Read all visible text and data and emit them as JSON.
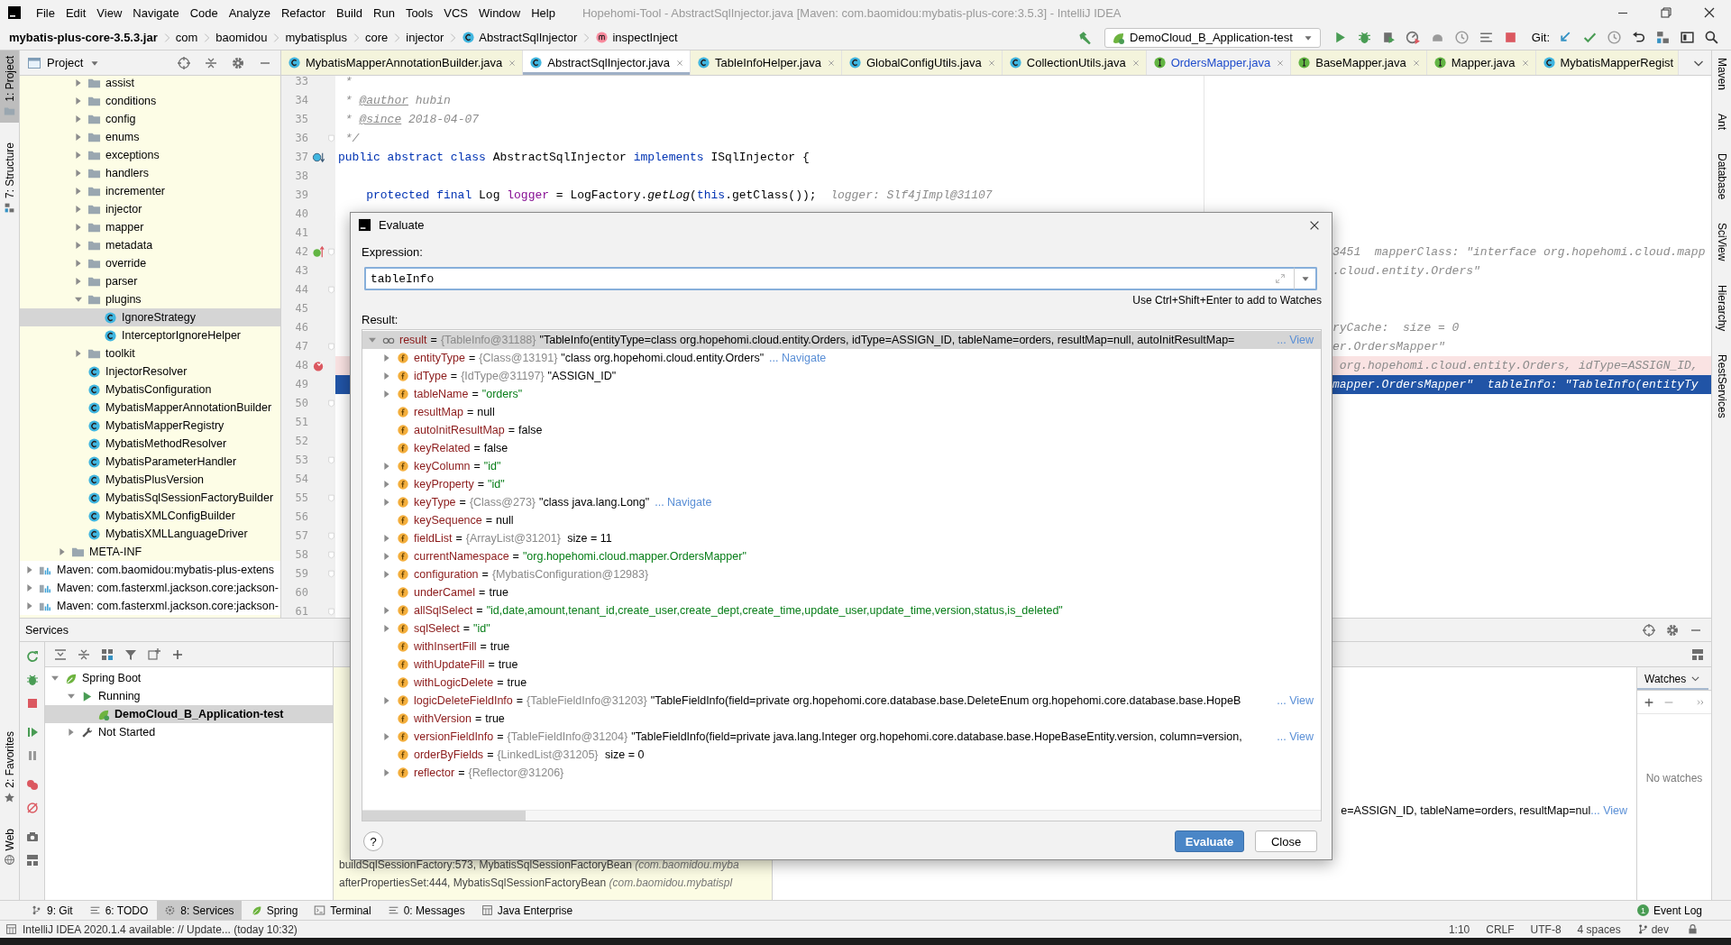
{
  "window": {
    "title": "Hopehomi-Tool - AbstractSqlInjector.java [Maven: com.baomidou:mybatis-plus-core:3.5.3] - IntelliJ IDEA"
  },
  "menu": [
    "File",
    "Edit",
    "View",
    "Navigate",
    "Code",
    "Analyze",
    "Refactor",
    "Build",
    "Run",
    "Tools",
    "VCS",
    "Window",
    "Help"
  ],
  "breadcrumbs": [
    {
      "label": "mybatis-plus-core-3.5.3.jar",
      "kind": "jar"
    },
    {
      "label": "com",
      "kind": "package"
    },
    {
      "label": "baomidou",
      "kind": "package"
    },
    {
      "label": "mybatisplus",
      "kind": "package"
    },
    {
      "label": "core",
      "kind": "package"
    },
    {
      "label": "injector",
      "kind": "package"
    },
    {
      "label": "AbstractSqlInjector",
      "kind": "class"
    },
    {
      "label": "inspectInject",
      "kind": "method"
    }
  ],
  "run_config": {
    "label": "DemoCloud_B_Application-test"
  },
  "vcs_label": "Git:",
  "left_tool_windows": {
    "top": [
      {
        "label": "1: Project",
        "selected": true
      },
      {
        "label": "7: Structure",
        "selected": false
      }
    ],
    "bottom": [
      {
        "label": "2: Favorites",
        "selected": false
      },
      {
        "label": "Web",
        "selected": false
      }
    ]
  },
  "right_tool_windows": [
    "Maven",
    "Ant",
    "Database",
    "SciView",
    "Hierarchy",
    "RestServices"
  ],
  "project": {
    "title": "Project",
    "tree": [
      {
        "children": [
          {
            "children": [
              {
                "children": [
                  {
                    "label": "assist",
                    "kind": "folder",
                    "expanded": false,
                    "selected": false
                  },
                  {
                    "label": "conditions",
                    "kind": "folder",
                    "expanded": false,
                    "selected": false
                  },
                  {
                    "label": "config",
                    "kind": "folder",
                    "expanded": false,
                    "selected": false
                  },
                  {
                    "label": "enums",
                    "kind": "folder",
                    "expanded": false,
                    "selected": false
                  },
                  {
                    "label": "exceptions",
                    "kind": "folder",
                    "expanded": false,
                    "selected": false
                  },
                  {
                    "label": "handlers",
                    "kind": "folder",
                    "expanded": false,
                    "selected": false
                  },
                  {
                    "label": "incrementer",
                    "kind": "folder",
                    "expanded": false,
                    "selected": false
                  },
                  {
                    "label": "injector",
                    "kind": "folder",
                    "expanded": false,
                    "selected": false
                  },
                  {
                    "label": "mapper",
                    "kind": "folder",
                    "expanded": false,
                    "selected": false
                  },
                  {
                    "label": "metadata",
                    "kind": "folder",
                    "expanded": false,
                    "selected": false
                  },
                  {
                    "label": "override",
                    "kind": "folder",
                    "expanded": false,
                    "selected": false
                  },
                  {
                    "label": "parser",
                    "kind": "folder",
                    "expanded": false,
                    "selected": false
                  },
                  {
                    "label": "plugins",
                    "kind": "folder",
                    "expanded": true,
                    "selected": false,
                    "children": [
                      {
                        "label": "IgnoreStrategy",
                        "kind": "class",
                        "selected": true
                      },
                      {
                        "label": "InterceptorIgnoreHelper",
                        "kind": "class",
                        "selected": false
                      }
                    ]
                  },
                  {
                    "label": "toolkit",
                    "kind": "folder",
                    "expanded": false,
                    "selected": false
                  },
                  {
                    "label": "InjectorResolver",
                    "kind": "class",
                    "selected": false
                  },
                  {
                    "label": "MybatisConfiguration",
                    "kind": "class",
                    "selected": false
                  },
                  {
                    "label": "MybatisMapperAnnotationBuilder",
                    "kind": "class",
                    "selected": false
                  },
                  {
                    "label": "MybatisMapperRegistry",
                    "kind": "class",
                    "selected": false
                  },
                  {
                    "label": "MybatisMethodResolver",
                    "kind": "class",
                    "selected": false
                  },
                  {
                    "label": "MybatisParameterHandler",
                    "kind": "class",
                    "selected": false
                  },
                  {
                    "label": "MybatisPlusVersion",
                    "kind": "class",
                    "selected": false
                  },
                  {
                    "label": "MybatisSqlSessionFactoryBuilder",
                    "kind": "class",
                    "selected": false
                  },
                  {
                    "label": "MybatisXMLConfigBuilder",
                    "kind": "class",
                    "selected": false
                  },
                  {
                    "label": "MybatisXMLLanguageDriver",
                    "kind": "class",
                    "selected": false
                  }
                ]
              },
              {
                "label": "META-INF",
                "kind": "folder",
                "expanded": false,
                "selected": false
              }
            ]
          }
        ]
      },
      {
        "label": "Maven: com.baomidou:mybatis-plus-extens",
        "kind": "library",
        "expanded": false,
        "selected": false
      },
      {
        "label": "Maven: com.fasterxml.jackson.core:jackson-",
        "kind": "library",
        "expanded": false,
        "selected": false
      },
      {
        "label": "Maven: com.fasterxml.jackson.core:jackson-",
        "kind": "library",
        "expanded": false,
        "selected": false
      }
    ]
  },
  "editor": {
    "tabs": [
      {
        "label": "MybatisMapperAnnotationBuilder.java",
        "kind": "class",
        "selected": false,
        "library": true,
        "modified": false,
        "closable": true
      },
      {
        "label": "AbstractSqlInjector.java",
        "kind": "class",
        "selected": true,
        "library": true,
        "modified": false,
        "closable": true
      },
      {
        "label": "TableInfoHelper.java",
        "kind": "class",
        "selected": false,
        "library": true,
        "modified": false,
        "closable": true
      },
      {
        "label": "GlobalConfigUtils.java",
        "kind": "class",
        "selected": false,
        "library": true,
        "modified": false,
        "closable": true
      },
      {
        "label": "CollectionUtils.java",
        "kind": "class",
        "selected": false,
        "library": true,
        "modified": false,
        "closable": true
      },
      {
        "label": "OrdersMapper.java",
        "kind": "interface",
        "selected": false,
        "library": false,
        "modified": true,
        "closable": true
      },
      {
        "label": "BaseMapper.java",
        "kind": "interface",
        "selected": false,
        "library": true,
        "modified": false,
        "closable": true
      },
      {
        "label": "Mapper.java",
        "kind": "interface",
        "selected": false,
        "library": true,
        "modified": false,
        "closable": true
      },
      {
        "label": "MybatisMapperRegist",
        "kind": "class",
        "selected": false,
        "library": true,
        "modified": false,
        "closable": false
      }
    ],
    "lines": [
      {
        "num": "33",
        "kind": "code",
        "fold": false,
        "tokens": [
          {
            "kind": "comment",
            "text": " *"
          }
        ]
      },
      {
        "num": "34",
        "kind": "code",
        "fold": false,
        "tokens": [
          {
            "kind": "comment",
            "text": " * "
          },
          {
            "kind": "tag",
            "text": "@author"
          },
          {
            "kind": "comment",
            "text": " hubin"
          }
        ]
      },
      {
        "num": "35",
        "kind": "code",
        "fold": false,
        "tokens": [
          {
            "kind": "comment",
            "text": " * "
          },
          {
            "kind": "tag",
            "text": "@since"
          },
          {
            "kind": "comment",
            "text": " 2018-04-07"
          }
        ]
      },
      {
        "num": "36",
        "kind": "code",
        "fold": true,
        "tokens": [
          {
            "kind": "comment",
            "text": " */"
          }
        ]
      },
      {
        "num": "37",
        "kind": "code",
        "fold": false,
        "tokens": [
          {
            "kind": "keyword",
            "text": "public abstract class"
          },
          {
            "kind": "plain",
            "text": " AbstractSqlInjector "
          },
          {
            "kind": "keyword",
            "text": "implements"
          },
          {
            "kind": "plain",
            "text": " ISqlInjector {"
          }
        ]
      },
      {
        "num": "38",
        "kind": "code",
        "fold": false
      },
      {
        "num": "39",
        "kind": "code",
        "fold": false,
        "tokens": [
          {
            "kind": "keyword",
            "text": "    protected final"
          },
          {
            "kind": "plain",
            "text": " Log "
          },
          {
            "kind": "field",
            "text": "logger"
          },
          {
            "kind": "plain",
            "text": " = LogFactory."
          },
          {
            "kind": "static",
            "text": "getLog"
          },
          {
            "kind": "plain",
            "text": "("
          },
          {
            "kind": "keyword",
            "text": "this"
          },
          {
            "kind": "plain",
            "text": ".getClass());"
          },
          {
            "kind": "hint",
            "text": "  logger: Slf4jImpl@31107"
          }
        ]
      },
      {
        "num": "40",
        "kind": "code",
        "fold": false
      },
      {
        "num": "41",
        "kind": "code",
        "fold": false
      },
      {
        "num": "42",
        "kind": "tail",
        "fold": true,
        "tokens": [
          {
            "kind": "hint",
            "text": "3451  mapperClass: \"interface org.hopehomi.cloud.mapp"
          }
        ]
      },
      {
        "num": "43",
        "kind": "tail",
        "fold": false,
        "tokens": [
          {
            "kind": "hint",
            "text": ".cloud.entity.Orders\""
          }
        ]
      },
      {
        "num": "44",
        "kind": "code",
        "fold": true
      },
      {
        "num": "45",
        "kind": "code",
        "fold": false
      },
      {
        "num": "46",
        "kind": "tail",
        "fold": false,
        "tokens": [
          {
            "kind": "hint",
            "text": "ryCache:  size = 0"
          }
        ]
      },
      {
        "num": "47",
        "kind": "tail",
        "fold": true,
        "tokens": [
          {
            "kind": "hint",
            "text": "er.OrdersMapper\""
          }
        ]
      },
      {
        "num": "48",
        "kind": "breakpoint",
        "fold": false,
        "tokens": [
          {
            "kind": "hint",
            "text": " org.hopehomi.cloud.entity.Orders, idType=ASSIGN_ID,"
          }
        ]
      },
      {
        "num": "49",
        "kind": "execution",
        "fold": false,
        "tokens": [
          {
            "kind": "hint",
            "text": "mapper.OrdersMapper\"  tableInfo: \"TableInfo(entityTy"
          }
        ]
      },
      {
        "num": "50",
        "kind": "code",
        "fold": true
      },
      {
        "num": "51",
        "kind": "code",
        "fold": false
      },
      {
        "num": "52",
        "kind": "code",
        "fold": false
      },
      {
        "num": "53",
        "kind": "code",
        "fold": true
      },
      {
        "num": "54",
        "kind": "code",
        "fold": false
      },
      {
        "num": "55",
        "kind": "code",
        "fold": true
      },
      {
        "num": "56",
        "kind": "code",
        "fold": false
      },
      {
        "num": "57",
        "kind": "code",
        "fold": true
      },
      {
        "num": "58",
        "kind": "code",
        "fold": true
      },
      {
        "num": "59",
        "kind": "code",
        "fold": true
      },
      {
        "num": "60",
        "kind": "code",
        "fold": false
      },
      {
        "num": "61",
        "kind": "code",
        "fold": true
      }
    ]
  },
  "services": {
    "title": "Services",
    "tree": [
      {
        "label": "Spring Boot",
        "expanded": true,
        "selected": false,
        "running": false,
        "children": [
          {
            "label": "Running",
            "expanded": true,
            "selected": false,
            "running": false,
            "children": [
              {
                "label": "DemoCloud_B_Application-test",
                "selected": true,
                "running": true
              }
            ]
          },
          {
            "label": "Not Started",
            "expanded": false,
            "selected": false,
            "running": false
          }
        ]
      }
    ],
    "frames": [
      {
        "method": "buildSqlSessionFactory:573, MybatisSqlSessionFactoryBean",
        "location": "(com.baomidou.myba"
      },
      {
        "method": "afterPropertiesSet:444, MybatisSqlSessionFactoryBean",
        "location": "(com.baomidou.mybatispl"
      }
    ],
    "variables": [
      {
        "value": "e=ASSIGN_ID, tableName=orders, resultMap=nul",
        "view_link": "... View"
      }
    ],
    "watches": {
      "title": "Watches",
      "empty_text": "No watches"
    }
  },
  "evaluate_dialog": {
    "title": "Evaluate",
    "expression_label": "Expression:",
    "expression": "tableInfo",
    "hint": "Use Ctrl+Shift+Enter to add to Watches",
    "result_label": "Result:",
    "help_label": "?",
    "buttons": [
      "Evaluate",
      "Close"
    ],
    "result": [
      {
        "kind": "watch",
        "name": "result",
        "op": "=",
        "type": "{TableInfo@31188}",
        "value": "\"TableInfo(entityType=class org.hopehomi.cloud.entity.Orders, idType=ASSIGN_ID, tableName=orders, resultMap=null, autoInitResultMap=",
        "view_link": "... View",
        "expanded": true,
        "selected": true,
        "children": [
          {
            "kind": "field",
            "name": "entityType",
            "op": "=",
            "type": "{Class@13191}",
            "value": "\"class org.hopehomi.cloud.entity.Orders\"",
            "navigate_link": "... Navigate",
            "expanded": false,
            "selected": false
          },
          {
            "kind": "field",
            "name": "idType",
            "op": "=",
            "type": "{IdType@31197}",
            "value": "\"ASSIGN_ID\"",
            "expanded": false,
            "selected": false
          },
          {
            "kind": "field",
            "name": "tableName",
            "op": "=",
            "string_value": "\"orders\"",
            "expanded": false,
            "selected": false
          },
          {
            "kind": "field",
            "name": "resultMap",
            "op": "=",
            "value": "null",
            "selected": false
          },
          {
            "kind": "field",
            "name": "autoInitResultMap",
            "op": "=",
            "value": "false",
            "selected": false
          },
          {
            "kind": "field",
            "name": "keyRelated",
            "op": "=",
            "value": "false",
            "selected": false
          },
          {
            "kind": "field",
            "name": "keyColumn",
            "op": "=",
            "string_value": "\"id\"",
            "expanded": false,
            "selected": false
          },
          {
            "kind": "field",
            "name": "keyProperty",
            "op": "=",
            "string_value": "\"id\"",
            "expanded": false,
            "selected": false
          },
          {
            "kind": "field",
            "name": "keyType",
            "op": "=",
            "type": "{Class@273}",
            "value": "\"class java.lang.Long\"",
            "navigate_link": "... Navigate",
            "expanded": false,
            "selected": false
          },
          {
            "kind": "field",
            "name": "keySequence",
            "op": "=",
            "value": "null",
            "selected": false
          },
          {
            "kind": "field",
            "name": "fieldList",
            "op": "=",
            "type": "{ArrayList@31201}",
            "value": " size = 11",
            "expanded": false,
            "selected": false
          },
          {
            "kind": "field",
            "name": "currentNamespace",
            "op": "=",
            "string_value": "\"org.hopehomi.cloud.mapper.OrdersMapper\"",
            "expanded": false,
            "selected": false
          },
          {
            "kind": "field",
            "name": "configuration",
            "op": "=",
            "type": "{MybatisConfiguration@12983}",
            "expanded": false,
            "selected": false
          },
          {
            "kind": "field",
            "name": "underCamel",
            "op": "=",
            "value": "true",
            "selected": false
          },
          {
            "kind": "field",
            "name": "allSqlSelect",
            "op": "=",
            "string_value": "\"id,date,amount,tenant_id,create_user,create_dept,create_time,update_user,update_time,version,status,is_deleted\"",
            "expanded": false,
            "selected": false
          },
          {
            "kind": "field",
            "name": "sqlSelect",
            "op": "=",
            "string_value": "\"id\"",
            "expanded": false,
            "selected": false
          },
          {
            "kind": "field",
            "name": "withInsertFill",
            "op": "=",
            "value": "true",
            "selected": false
          },
          {
            "kind": "field",
            "name": "withUpdateFill",
            "op": "=",
            "value": "true",
            "selected": false
          },
          {
            "kind": "field",
            "name": "withLogicDelete",
            "op": "=",
            "value": "true",
            "selected": false
          },
          {
            "kind": "field",
            "name": "logicDeleteFieldInfo",
            "op": "=",
            "type": "{TableFieldInfo@31203}",
            "value": "\"TableFieldInfo(field=private org.hopehomi.core.database.base.DeleteEnum org.hopehomi.core.database.base.HopeB",
            "view_link": "... View",
            "expanded": false,
            "selected": false
          },
          {
            "kind": "field",
            "name": "withVersion",
            "op": "=",
            "value": "true",
            "selected": false
          },
          {
            "kind": "field",
            "name": "versionFieldInfo",
            "op": "=",
            "type": "{TableFieldInfo@31204}",
            "value": "\"TableFieldInfo(field=private java.lang.Integer org.hopehomi.core.database.base.HopeBaseEntity.version, column=version,",
            "view_link": "... View",
            "expanded": false,
            "selected": false
          },
          {
            "kind": "field",
            "name": "orderByFields",
            "op": "=",
            "type": "{LinkedList@31205}",
            "value": " size = 0",
            "selected": false
          },
          {
            "kind": "field",
            "name": "reflector",
            "op": "=",
            "type": "{Reflector@31206}",
            "expanded": false,
            "selected": false
          }
        ]
      }
    ]
  },
  "tool_tabs": [
    {
      "label": "9: Git",
      "selected": false
    },
    {
      "label": "6: TODO",
      "selected": false
    },
    {
      "label": "8: Services",
      "selected": true
    },
    {
      "label": "Spring",
      "selected": false
    },
    {
      "label": "Terminal",
      "selected": false
    },
    {
      "label": "0: Messages",
      "selected": false
    },
    {
      "label": "Java Enterprise",
      "selected": false
    }
  ],
  "event_log": {
    "label": "Event Log",
    "badge": "1"
  },
  "status_bar": {
    "message": "IntelliJ IDEA 2020.1.4 available: // Update... (today 10:32)",
    "items": [
      "1:10",
      "CRLF",
      "UTF-8",
      "4 spaces"
    ],
    "branch": "dev"
  }
}
